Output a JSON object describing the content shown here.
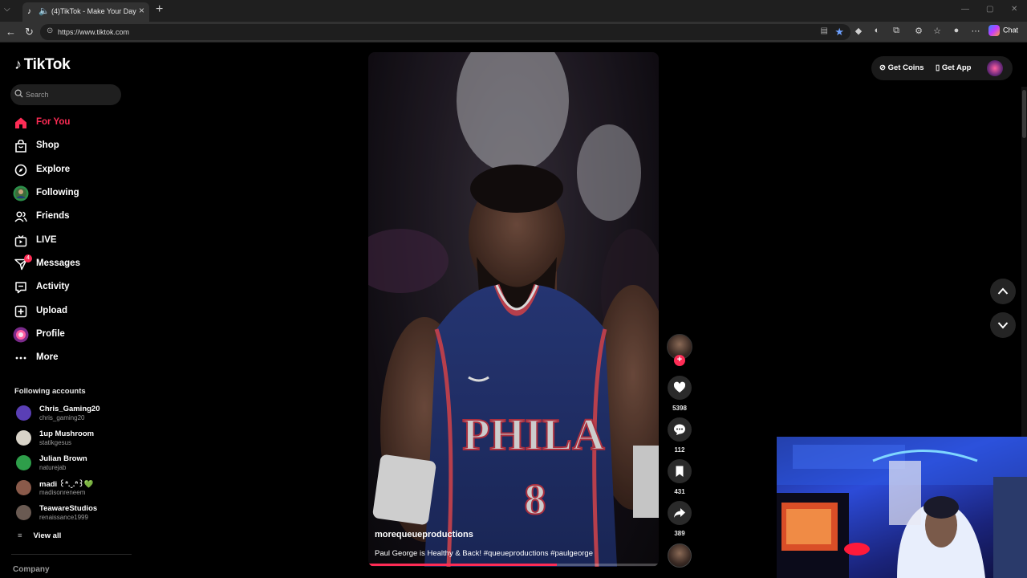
{
  "browser": {
    "tab_title": "(4)TikTok - Make Your Day",
    "url": "https://www.tiktok.com",
    "chat_label": "Chat"
  },
  "tiktok": {
    "logo": "TikTok",
    "search_placeholder": "Search",
    "nav": [
      {
        "label": "For You",
        "icon": "home-icon",
        "active": true
      },
      {
        "label": "Shop",
        "icon": "shop-icon"
      },
      {
        "label": "Explore",
        "icon": "compass-icon"
      },
      {
        "label": "Following",
        "icon": "following-avatar-icon"
      },
      {
        "label": "Friends",
        "icon": "friends-icon"
      },
      {
        "label": "LIVE",
        "icon": "live-icon"
      },
      {
        "label": "Messages",
        "icon": "messages-icon",
        "badge": "4"
      },
      {
        "label": "Activity",
        "icon": "activity-icon"
      },
      {
        "label": "Upload",
        "icon": "upload-icon"
      },
      {
        "label": "Profile",
        "icon": "profile-avatar-icon"
      },
      {
        "label": "More",
        "icon": "more-icon"
      }
    ],
    "following_title": "Following accounts",
    "accounts": [
      {
        "name": "Chris_Gaming20",
        "handle": "chris_gaming20",
        "color": "#5a3fb5"
      },
      {
        "name": "1up Mushroom",
        "handle": "statikgesus",
        "color": "#d8d3c8"
      },
      {
        "name": "Julian Brown",
        "handle": "naturejab",
        "color": "#2e9e4a"
      },
      {
        "name": "madi ꒰ᐢ.ˬ.ᐢ꒱💚",
        "handle": "madisonreneem",
        "color": "#8a5a4a"
      },
      {
        "name": "TeawareStudios",
        "handle": "renaissance1999",
        "color": "#6a5a52"
      }
    ],
    "view_all": "View all",
    "company": "Company",
    "get_coins": "Get Coins",
    "get_app": "Get App",
    "video": {
      "author": "morequeueproductions",
      "description": "Paul George is Healthy & Back! #queueproductions #paulgeorge",
      "jersey_text": "PHILA",
      "jersey_number": "8",
      "progress": 0.65
    },
    "actions": {
      "likes": "5398",
      "comments": "112",
      "saves": "431",
      "shares": "389"
    }
  }
}
